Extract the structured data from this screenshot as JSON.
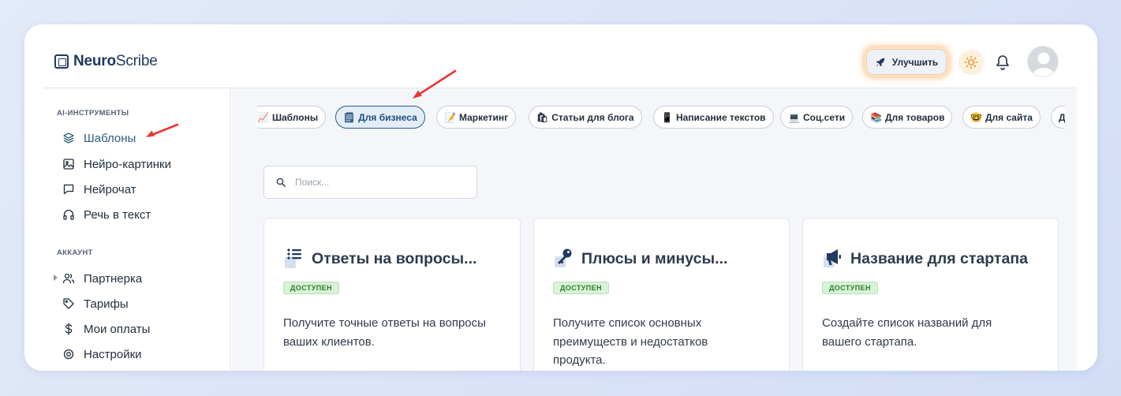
{
  "header": {
    "logo_bold": "Neuro",
    "logo_light": "Scribe",
    "upgrade_label": "Улучшить"
  },
  "sidebar": {
    "sections": [
      {
        "title": "AI-ИНСТРУМЕНТЫ",
        "items": [
          {
            "label": "Шаблоны",
            "icon": "layers-icon",
            "active": true
          },
          {
            "label": "Нейро-картинки",
            "icon": "image-icon"
          },
          {
            "label": "Нейрочат",
            "icon": "chat-bubble-icon"
          },
          {
            "label": "Речь в текст",
            "icon": "headphones-icon"
          }
        ]
      },
      {
        "title": "АККАУНТ",
        "items": [
          {
            "label": "Партнерка",
            "icon": "users-icon"
          },
          {
            "label": "Тарифы",
            "icon": "tag-icon"
          },
          {
            "label": "Мои оплаты",
            "icon": "dollar-icon"
          },
          {
            "label": "Настройки",
            "icon": "settings-icon"
          }
        ]
      }
    ]
  },
  "categories": [
    {
      "emoji": "📈",
      "label": "Шаблоны"
    },
    {
      "emoji": "🗒",
      "label": "Для бизнеса",
      "active": true
    },
    {
      "emoji": "📝",
      "label": "Маркетинг"
    },
    {
      "emoji": "🛍",
      "label": "Статьи для блога"
    },
    {
      "emoji": "📱",
      "label": "Написание текстов"
    },
    {
      "emoji": "💻",
      "label": "Соц.сети"
    },
    {
      "emoji": "📚",
      "label": "Для товаров"
    },
    {
      "emoji": "🤓",
      "label": "Для сайта"
    },
    {
      "emoji": "",
      "label": "Д"
    }
  ],
  "search": {
    "placeholder": "Поиск..."
  },
  "cards": [
    {
      "icon": "list-icon",
      "title": "Ответы на вопросы...",
      "badge": "ДОСТУПЕН",
      "desc": "Получите точные ответы на вопросы ваших клиентов."
    },
    {
      "icon": "key-icon",
      "title": "Плюсы и минусы...",
      "badge": "ДОСТУПЕН",
      "desc": "Получите список основных преимуществ и недостатков продукта."
    },
    {
      "icon": "megaphone-icon",
      "title": "Название для стартапа",
      "badge": "ДОСТУПЕН",
      "desc": "Создайте список названий для вашего стартапа."
    }
  ],
  "colors": {
    "accent": "#2d5d8f",
    "badge_bg": "#d8f3d7",
    "annotation_arrow": "#e53935"
  }
}
